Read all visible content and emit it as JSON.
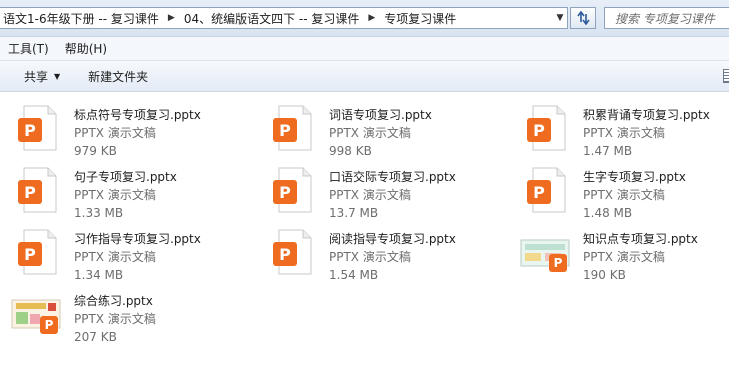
{
  "address": {
    "crumbs": [
      "语文1-6年级下册 -- 复习课件",
      "04、统编版语文四下 -- 复习课件",
      "专项复习课件"
    ]
  },
  "search": {
    "placeholder": "搜索 专项复习课件"
  },
  "menu": {
    "tools": "工具(T)",
    "help": "帮助(H)"
  },
  "toolbar": {
    "share": "共享",
    "new_folder": "新建文件夹"
  },
  "colors": {
    "pptx_orange": "#ee6b1f",
    "accent": "#8fa3bd"
  },
  "files": [
    {
      "name": "标点符号专项复习.pptx",
      "type": "PPTX 演示文稿",
      "size": "979 KB",
      "icon": "pptx-icon"
    },
    {
      "name": "词语专项复习.pptx",
      "type": "PPTX 演示文稿",
      "size": "998 KB",
      "icon": "pptx-icon"
    },
    {
      "name": "积累背诵专项复习.pptx",
      "type": "PPTX 演示文稿",
      "size": "1.47 MB",
      "icon": "pptx-icon"
    },
    {
      "name": "句子专项复习.pptx",
      "type": "PPTX 演示文稿",
      "size": "1.33 MB",
      "icon": "pptx-icon"
    },
    {
      "name": "口语交际专项复习.pptx",
      "type": "PPTX 演示文稿",
      "size": "13.7 MB",
      "icon": "pptx-icon"
    },
    {
      "name": "生字专项复习.pptx",
      "type": "PPTX 演示文稿",
      "size": "1.48 MB",
      "icon": "pptx-icon"
    },
    {
      "name": "习作指导专项复习.pptx",
      "type": "PPTX 演示文稿",
      "size": "1.34 MB",
      "icon": "pptx-icon"
    },
    {
      "name": "阅读指导专项复习.pptx",
      "type": "PPTX 演示文稿",
      "size": "1.54 MB",
      "icon": "pptx-icon"
    },
    {
      "name": "知识点专项复习.pptx",
      "type": "PPTX 演示文稿",
      "size": "190 KB",
      "icon": "pptx-thumbnail"
    },
    {
      "name": "综合练习.pptx",
      "type": "PPTX 演示文稿",
      "size": "207 KB",
      "icon": "pptx-thumbnail"
    }
  ]
}
